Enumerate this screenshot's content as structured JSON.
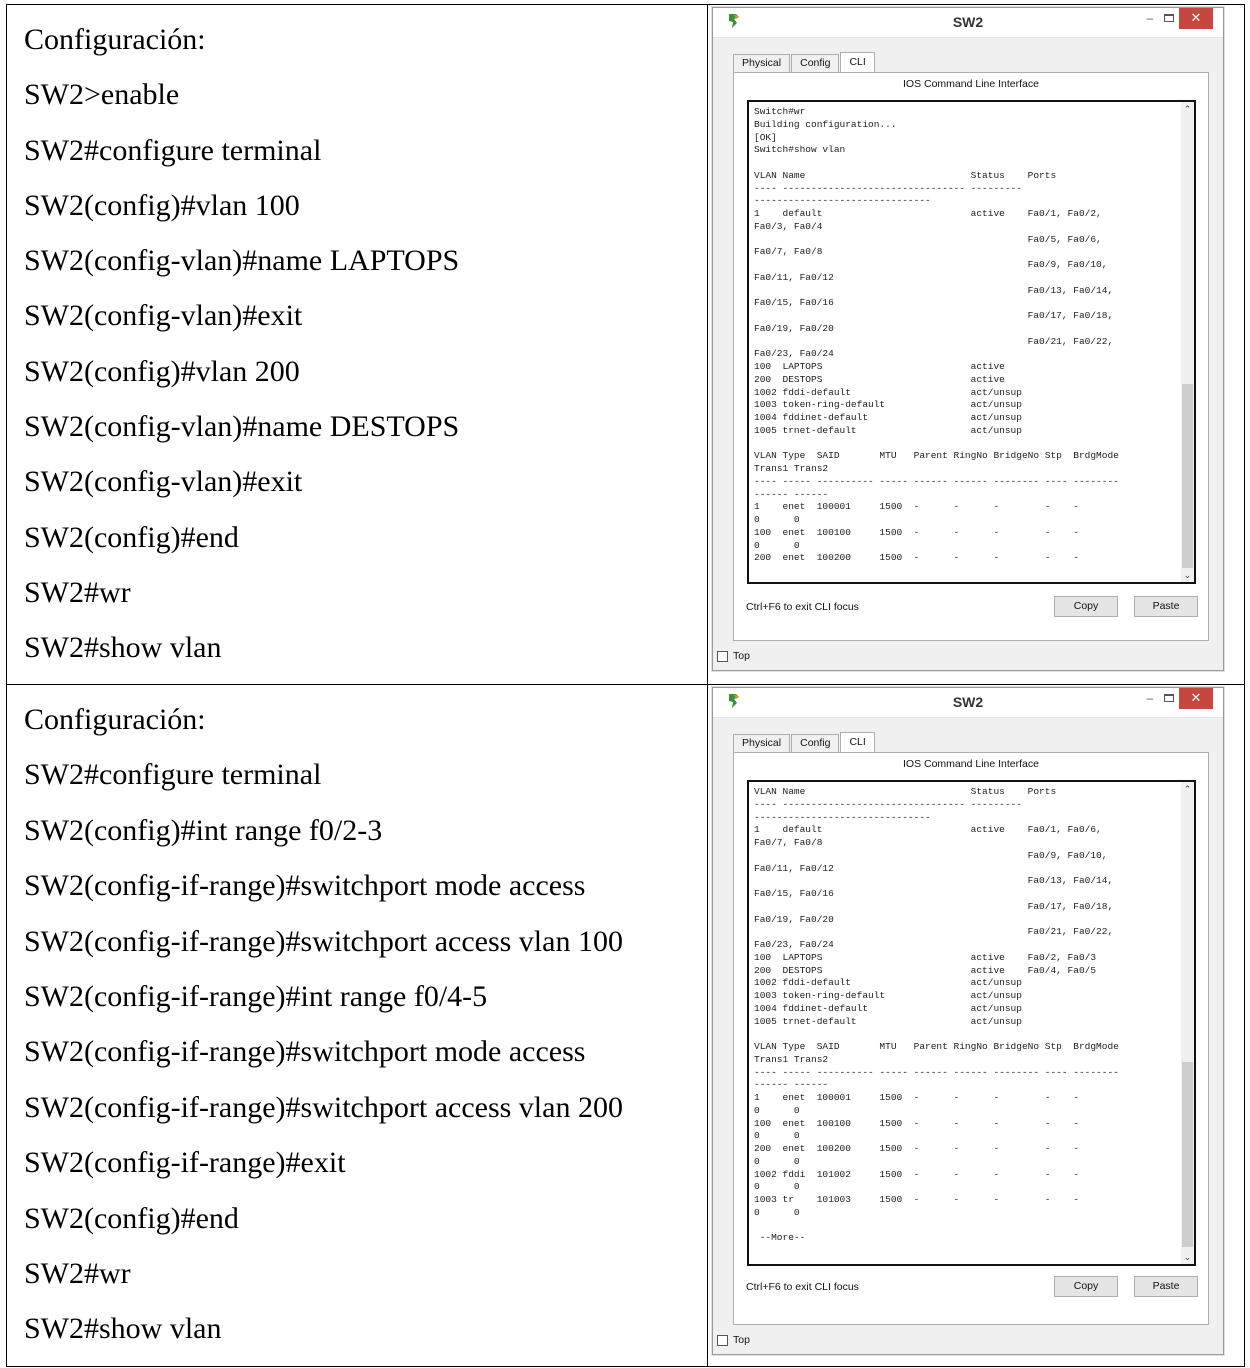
{
  "sections": [
    {
      "commands": [
        "Configuración:",
        "SW2>enable",
        "SW2#configure terminal",
        "SW2(config)#vlan 100",
        "SW2(config-vlan)#name LAPTOPS",
        "SW2(config-vlan)#exit",
        "SW2(config)#vlan 200",
        "SW2(config-vlan)#name DESTOPS",
        "SW2(config-vlan)#exit",
        "SW2(config)#end",
        "SW2#wr",
        "SW2#show vlan"
      ],
      "window": {
        "title": "SW2",
        "tabs": [
          "Physical",
          "Config",
          "CLI"
        ],
        "active_tab": "CLI",
        "cli_header": "IOS Command Line Interface",
        "terminal_text": "Switch#wr\nBuilding configuration...\n[OK]\nSwitch#show vlan\n\nVLAN Name                             Status    Ports\n---- -------------------------------- ---------\n-------------------------------\n1    default                          active    Fa0/1, Fa0/2,\nFa0/3, Fa0/4\n                                                Fa0/5, Fa0/6,\nFa0/7, Fa0/8\n                                                Fa0/9, Fa0/10,\nFa0/11, Fa0/12\n                                                Fa0/13, Fa0/14,\nFa0/15, Fa0/16\n                                                Fa0/17, Fa0/18,\nFa0/19, Fa0/20\n                                                Fa0/21, Fa0/22,\nFa0/23, Fa0/24\n100  LAPTOPS                          active\n200  DESTOPS                          active\n1002 fddi-default                     act/unsup\n1003 token-ring-default               act/unsup\n1004 fddinet-default                  act/unsup\n1005 trnet-default                    act/unsup\n\nVLAN Type  SAID       MTU   Parent RingNo BridgeNo Stp  BrdgMode\nTrans1 Trans2\n---- ----- ---------- ----- ------ ------ -------- ---- --------\n------ ------\n1    enet  100001     1500  -      -      -        -    -\n0      0\n100  enet  100100     1500  -      -      -        -    -\n0      0\n200  enet  100200     1500  -      -      -        -    -",
        "focus_hint": "Ctrl+F6 to exit CLI focus",
        "copy_label": "Copy",
        "paste_label": "Paste",
        "top_label": "Top"
      }
    },
    {
      "commands": [
        "Configuración:",
        "SW2#configure terminal",
        "SW2(config)#int range f0/2-3",
        "SW2(config-if-range)#switchport mode access",
        "SW2(config-if-range)#switchport access vlan 100",
        "SW2(config-if-range)#int range f0/4-5",
        "SW2(config-if-range)#switchport mode access",
        "SW2(config-if-range)#switchport access vlan 200",
        "SW2(config-if-range)#exit",
        "SW2(config)#end",
        "SW2#wr",
        "SW2#show vlan"
      ],
      "window": {
        "title": "SW2",
        "tabs": [
          "Physical",
          "Config",
          "CLI"
        ],
        "active_tab": "CLI",
        "cli_header": "IOS Command Line Interface",
        "terminal_text": "VLAN Name                             Status    Ports\n---- -------------------------------- ---------\n-------------------------------\n1    default                          active    Fa0/1, Fa0/6,\nFa0/7, Fa0/8\n                                                Fa0/9, Fa0/10,\nFa0/11, Fa0/12\n                                                Fa0/13, Fa0/14,\nFa0/15, Fa0/16\n                                                Fa0/17, Fa0/18,\nFa0/19, Fa0/20\n                                                Fa0/21, Fa0/22,\nFa0/23, Fa0/24\n100  LAPTOPS                          active    Fa0/2, Fa0/3\n200  DESTOPS                          active    Fa0/4, Fa0/5\n1002 fddi-default                     act/unsup\n1003 token-ring-default               act/unsup\n1004 fddinet-default                  act/unsup\n1005 trnet-default                    act/unsup\n\nVLAN Type  SAID       MTU   Parent RingNo BridgeNo Stp  BrdgMode\nTrans1 Trans2\n---- ----- ---------- ----- ------ ------ -------- ---- --------\n------ ------\n1    enet  100001     1500  -      -      -        -    -\n0      0\n100  enet  100100     1500  -      -      -        -    -\n0      0\n200  enet  100200     1500  -      -      -        -    -\n0      0\n1002 fddi  101002     1500  -      -      -        -    -\n0      0\n1003 tr    101003     1500  -      -      -        -    -\n0      0\n\n --More--",
        "focus_hint": "Ctrl+F6 to exit CLI focus",
        "copy_label": "Copy",
        "paste_label": "Paste",
        "top_label": "Top"
      }
    }
  ],
  "colors": {
    "close_button": "#c7463d",
    "window_bg": "#f0f0f0",
    "terminal_border": "#111111"
  }
}
